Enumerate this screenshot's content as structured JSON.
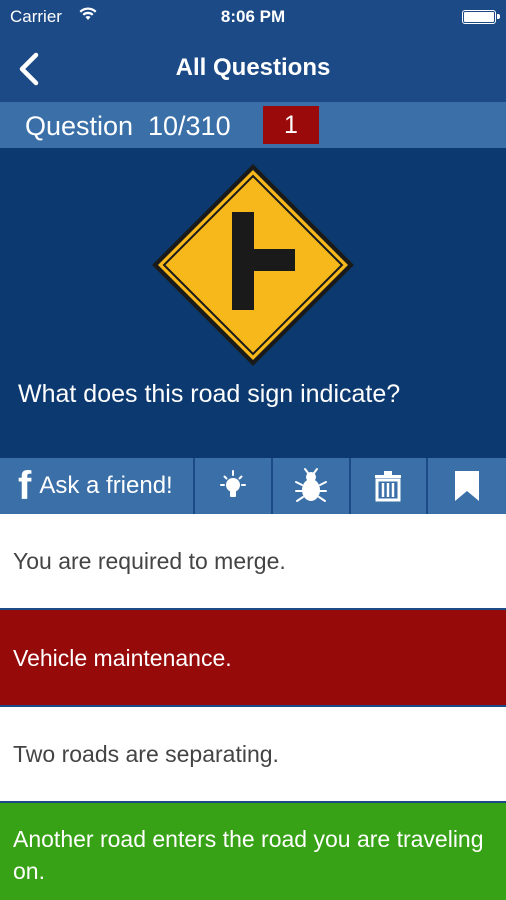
{
  "status_bar": {
    "carrier": "Carrier",
    "time": "8:06 PM"
  },
  "nav": {
    "title": "All Questions",
    "back_icon": "chevron-left-icon"
  },
  "question": {
    "label": "Question",
    "progress": "10/310",
    "badge": "1",
    "text": "What does this road sign indicate?",
    "sign_icon": "side-road-warning-sign"
  },
  "toolbar": {
    "ask_icon": "facebook-icon",
    "ask_label": "Ask a friend!",
    "icons": [
      "lightbulb-icon",
      "bug-icon",
      "trash-icon",
      "bookmark-icon"
    ]
  },
  "answers": [
    {
      "text": "You are required to merge.",
      "state": "neutral"
    },
    {
      "text": "Vehicle maintenance.",
      "state": "wrong"
    },
    {
      "text": "Two roads are separating.",
      "state": "neutral"
    },
    {
      "text": "Another road enters the road you are traveling on.",
      "state": "correct"
    }
  ],
  "colors": {
    "nav": "#1c4a86",
    "header": "#3a6fa8",
    "panel": "#0c3a70",
    "wrong": "#960a0a",
    "correct": "#37a215",
    "sign": "#f7b81c"
  }
}
